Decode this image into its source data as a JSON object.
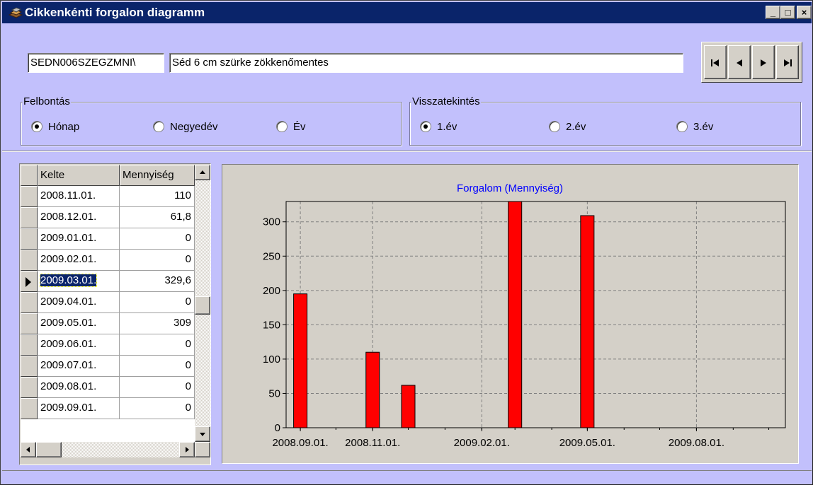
{
  "window": {
    "title": "Cikkenkénti forgalon diagramm",
    "controls": {
      "minimize": "_",
      "maximize": "□",
      "close": "×"
    }
  },
  "item": {
    "code": "SEDN006SZEGZMNI\\",
    "name": "Séd 6 cm szürke zökkenőmentes"
  },
  "nav": {
    "first_icon": "first-record-icon",
    "prev_icon": "previous-record-icon",
    "next_icon": "next-record-icon",
    "last_icon": "last-record-icon"
  },
  "resolution": {
    "label": "Felbontás",
    "options": [
      "Hónap",
      "Negyedév",
      "Év"
    ],
    "selected": 0
  },
  "lookback": {
    "label": "Visszatekintés",
    "options": [
      "1.év",
      "2.év",
      "3.év"
    ],
    "selected": 0
  },
  "table": {
    "headers": [
      "Kelte",
      "Mennyiség"
    ],
    "rows": [
      [
        "2008.11.01.",
        "110"
      ],
      [
        "2008.12.01.",
        "61,8"
      ],
      [
        "2009.01.01.",
        "0"
      ],
      [
        "2009.02.01.",
        "0"
      ],
      [
        "2009.03.01.",
        "329,6"
      ],
      [
        "2009.04.01.",
        "0"
      ],
      [
        "2009.05.01.",
        "309"
      ],
      [
        "2009.06.01.",
        "0"
      ],
      [
        "2009.07.01.",
        "0"
      ],
      [
        "2009.08.01.",
        "0"
      ],
      [
        "2009.09.01.",
        "0"
      ]
    ],
    "selected_row": 4
  },
  "chart_data": {
    "type": "bar",
    "title": "Forgalom (Mennyiség)",
    "xlabel": "",
    "ylabel": "",
    "x": [
      "2008.09.01.",
      "2008.11.01.",
      "2008.12.01.",
      "2009.03.01.",
      "2009.05.01."
    ],
    "values": [
      195,
      110,
      61.8,
      329.6,
      309
    ],
    "x_tick_labels": [
      "2008.09.01.",
      "2008.11.01.",
      "2009.02.01.",
      "2009.05.01.",
      "2009.08.01."
    ],
    "ylim": [
      0,
      329.6
    ],
    "y_ticks": [
      0,
      50,
      100,
      150,
      200,
      250,
      300
    ],
    "grid": true,
    "colors": {
      "bar": "#ff0000",
      "title": "#0000ff",
      "plot_bg": "#d4d0c8"
    }
  }
}
